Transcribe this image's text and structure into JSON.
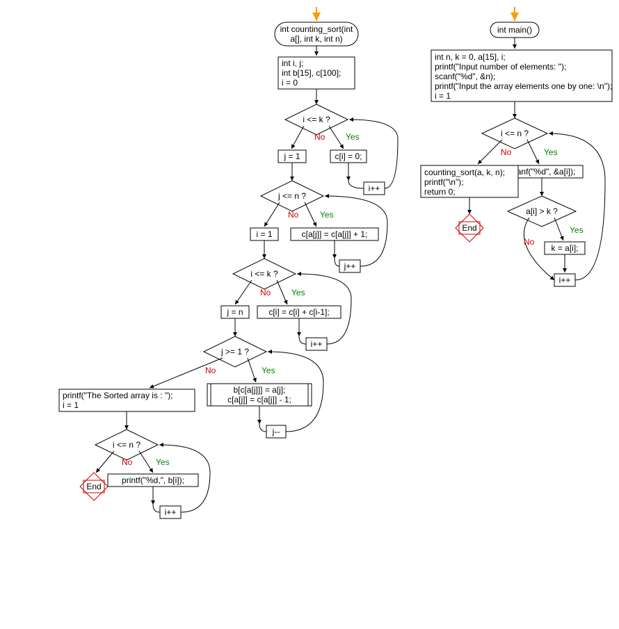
{
  "colors": {
    "yes": "#008000",
    "no": "#cc0000",
    "entry": "#ff9900",
    "end_border": "#cc0000"
  },
  "yes_label": "Yes",
  "no_label": "No",
  "end_label": "End",
  "cs_func_sig1": "int counting_sort(int",
  "cs_func_sig2": "a[], int k, int n)",
  "cs_init1": "int i, j;",
  "cs_init2": "int b[15], c[100];",
  "cs_init3": "i = 0",
  "cs_cond1": "i <= k ?",
  "cs_cond1_yes": "c[i] = 0;",
  "cs_cond1_no": "j = 1",
  "cs_cond1_inc": "i++",
  "cs_cond2": "j <= n ?",
  "cs_cond2_yes": "c[a[j]] = c[a[j]] + 1;",
  "cs_cond2_no": "i = 1",
  "cs_cond2_inc": "j++",
  "cs_cond3": "i <= k ?",
  "cs_cond3_yes": "c[i] = c[i] + c[i-1];",
  "cs_cond3_no": "j = n",
  "cs_cond3_inc": "i++",
  "cs_cond4": "j >= 1 ?",
  "cs_cond4_yes1": "b[c[a[j]]] = a[j];",
  "cs_cond4_yes2": "c[a[j]] = c[a[j]] - 1;",
  "cs_cond4_no1": "printf(\"The Sorted array is : \");",
  "cs_cond4_no2": "i = 1",
  "cs_cond4_dec": "j--",
  "cs_cond5": "i <= n ?",
  "cs_cond5_yes": "printf(\"%d,\", b[i]);",
  "cs_cond5_inc": "i++",
  "m_func_sig": "int main()",
  "m_init1": "int n, k = 0, a[15], i;",
  "m_init2": "printf(\"Input number of elements:  \");",
  "m_init3": "scanf(\"%d\", &n);",
  "m_init4": "printf(\"Input the array elements one  by one: \\n\");",
  "m_init5": "i = 1",
  "m_cond1": "i <= n ?",
  "m_cond1_yes": "scanf(\"%d\", &a[i]);",
  "m_cond1_no1": "counting_sort(a, k, n);",
  "m_cond1_no2": "printf(\"\\n\");",
  "m_cond1_no3": "return 0;",
  "m_cond2": "a[i] > k ?",
  "m_cond2_yes": "k = a[i];",
  "m_cond2_inc": "i++"
}
